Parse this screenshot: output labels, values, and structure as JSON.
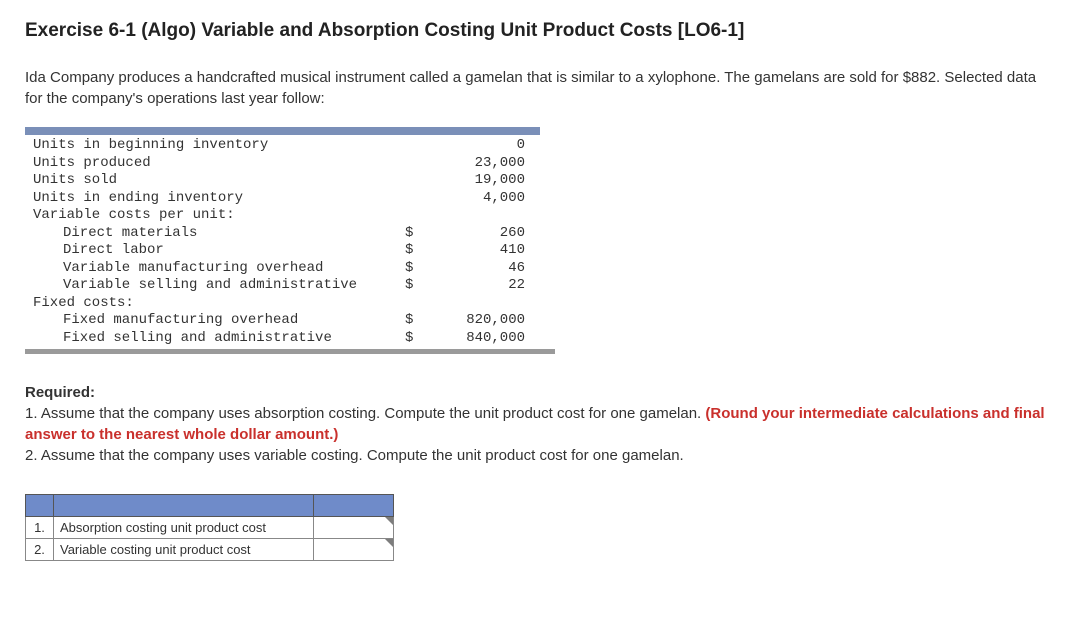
{
  "title": "Exercise 6-1 (Algo) Variable and Absorption Costing Unit Product Costs [LO6-1]",
  "intro": "Ida Company produces a handcrafted musical instrument called a gamelan that is similar to a xylophone. The gamelans are sold for $882. Selected data for the company's operations last year follow:",
  "data_rows": [
    {
      "label": "Units in beginning inventory",
      "indent": false,
      "currency": "",
      "value": "0"
    },
    {
      "label": "Units produced",
      "indent": false,
      "currency": "",
      "value": "23,000"
    },
    {
      "label": "Units sold",
      "indent": false,
      "currency": "",
      "value": "19,000"
    },
    {
      "label": "Units in ending inventory",
      "indent": false,
      "currency": "",
      "value": "4,000"
    },
    {
      "label": "Variable costs per unit:",
      "indent": false,
      "currency": "",
      "value": ""
    },
    {
      "label": "Direct materials",
      "indent": true,
      "currency": "$",
      "value": "260"
    },
    {
      "label": "Direct labor",
      "indent": true,
      "currency": "$",
      "value": "410"
    },
    {
      "label": "Variable manufacturing overhead",
      "indent": true,
      "currency": "$",
      "value": "46"
    },
    {
      "label": "Variable selling and administrative",
      "indent": true,
      "currency": "$",
      "value": "22"
    },
    {
      "label": "Fixed costs:",
      "indent": false,
      "currency": "",
      "value": ""
    },
    {
      "label": "Fixed manufacturing overhead",
      "indent": true,
      "currency": "$",
      "value": "820,000"
    },
    {
      "label": "Fixed selling and administrative",
      "indent": true,
      "currency": "$",
      "value": "840,000"
    }
  ],
  "required": {
    "heading": "Required:",
    "item1_prefix": "1. Assume that the company uses absorption costing. Compute the unit product cost for one gamelan. ",
    "item1_red": "(Round your intermediate calculations and final answer to the nearest whole dollar amount.)",
    "item2": "2. Assume that the company uses variable costing. Compute the unit product cost for one gamelan."
  },
  "answer_table": {
    "rows": [
      {
        "num": "1.",
        "label": "Absorption costing unit product cost"
      },
      {
        "num": "2.",
        "label": "Variable costing unit product cost"
      }
    ]
  }
}
